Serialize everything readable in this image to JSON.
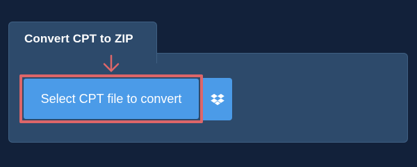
{
  "panel": {
    "title": "Convert CPT to ZIP"
  },
  "actions": {
    "select_label": "Select CPT file to convert",
    "dropbox_icon": "dropbox-icon"
  },
  "annotation": {
    "arrow_icon": "down-arrow-icon",
    "highlight_color": "#dd6669"
  },
  "colors": {
    "page_background": "#12213a",
    "panel_background": "#2d4a6b",
    "button_blue": "#4b9be8"
  }
}
